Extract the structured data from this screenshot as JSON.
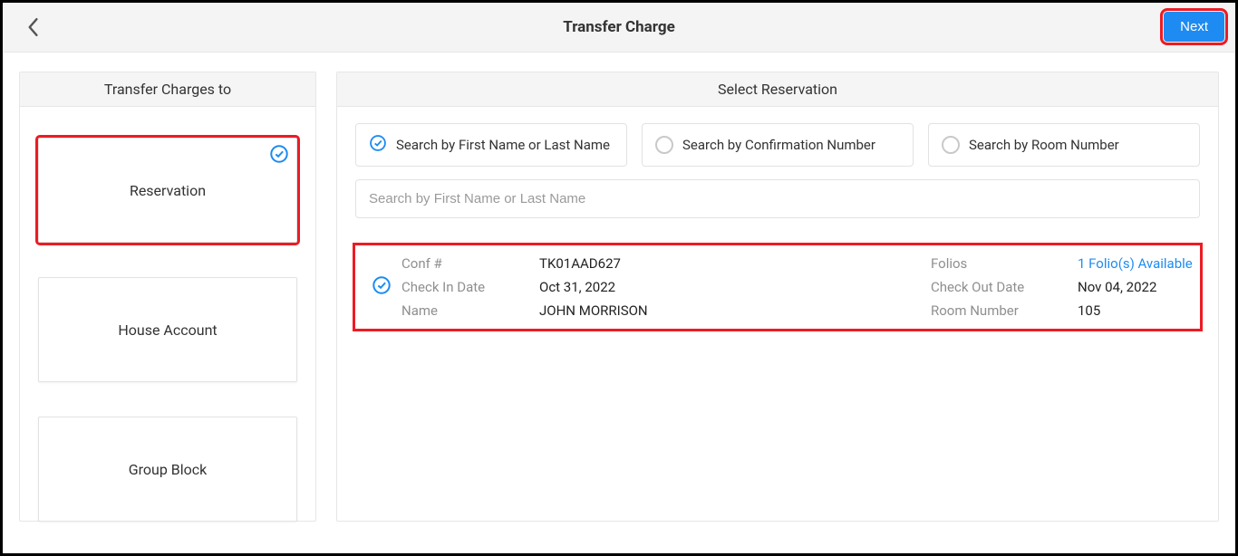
{
  "header": {
    "title": "Transfer Charge",
    "next_label": "Next"
  },
  "left_panel": {
    "title": "Transfer Charges to",
    "tiles": {
      "reservation": "Reservation",
      "house_account": "House Account",
      "group_block": "Group Block"
    }
  },
  "right_panel": {
    "title": "Select Reservation",
    "search_tabs": {
      "by_name": "Search by First Name or Last Name",
      "by_conf": "Search by Confirmation Number",
      "by_room": "Search by Room Number"
    },
    "search_placeholder": "Search by First Name or Last Name",
    "result": {
      "labels": {
        "conf": "Conf #",
        "checkin": "Check In Date",
        "name": "Name",
        "folios": "Folios",
        "checkout": "Check Out Date",
        "room": "Room Number"
      },
      "conf": "TK01AAD627",
      "checkin": "Oct 31, 2022",
      "name": "JOHN MORRISON",
      "folios": "1 Folio(s) Available",
      "checkout": "Nov 04, 2022",
      "room": "105"
    }
  }
}
